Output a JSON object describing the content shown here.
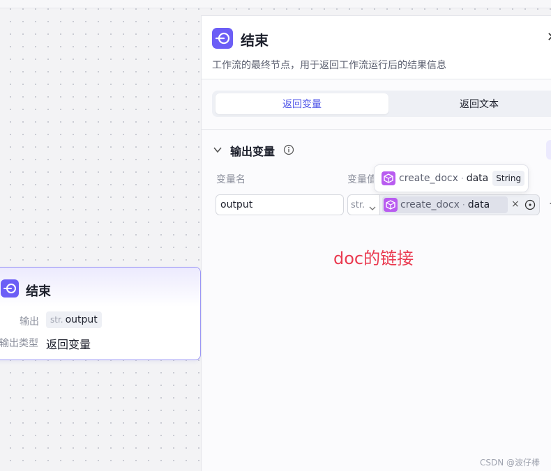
{
  "canvas_node": {
    "title": "结束",
    "output_label": "输出",
    "output_type_short": "str.",
    "output_name": "output",
    "output_type_label": "输出类型",
    "output_type_value": "返回变量"
  },
  "panel": {
    "title": "结束",
    "description": "工作流的最终节点，用于返回工作流运行后的结果信息",
    "close_icon": "close-icon",
    "tabs": [
      {
        "label": "返回变量",
        "active": true
      },
      {
        "label": "返回文本",
        "active": false
      }
    ],
    "section": {
      "title": "输出变量",
      "col_name": "变量名",
      "col_value": "变量值"
    },
    "row": {
      "name": "output",
      "type_short": "str.",
      "ref_node": "create_docx",
      "ref_dot": "·",
      "ref_field": "data",
      "clear": "×",
      "more": "−"
    },
    "tooltip": {
      "node": "create_docx",
      "dot": "·",
      "field": "data",
      "type": "String"
    }
  },
  "annotation": "doc的链接",
  "watermark": "CSDN @波仔棒",
  "colors": {
    "accent": "#4d53e8",
    "node_icon": "#6c5ef6",
    "var_icon": "#b95cf0",
    "annotation": "#ea3a50"
  }
}
